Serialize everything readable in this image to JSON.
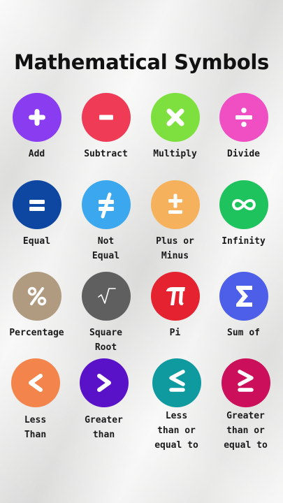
{
  "title": "Mathematical Symbols",
  "symbols": [
    {
      "label": "Add",
      "color": "#8a3cf0",
      "icon": "plus-icon"
    },
    {
      "label": "Subtract",
      "color": "#ef3b55",
      "icon": "minus-icon"
    },
    {
      "label": "Multiply",
      "color": "#7ee03f",
      "icon": "multiply-icon"
    },
    {
      "label": "Divide",
      "color": "#f04fc4",
      "icon": "divide-icon"
    },
    {
      "label": "Equal",
      "color": "#0d47a1",
      "icon": "equal-icon"
    },
    {
      "label": "Not\nEqual",
      "color": "#3ba7ef",
      "icon": "not-equal-icon"
    },
    {
      "label": "Plus or\nMinus",
      "color": "#f6b15c",
      "icon": "plus-minus-icon"
    },
    {
      "label": "Infinity",
      "color": "#1fc35d",
      "icon": "infinity-icon"
    },
    {
      "label": "Percentage",
      "color": "#b09b80",
      "icon": "percent-icon"
    },
    {
      "label": "Square\nRoot",
      "color": "#5f5f5f",
      "icon": "square-root-icon"
    },
    {
      "label": "Pi",
      "color": "#e5222f",
      "icon": "pi-icon"
    },
    {
      "label": "Sum of",
      "color": "#4d5fe8",
      "icon": "sigma-icon"
    },
    {
      "label": "Less\nThan",
      "color": "#f3844c",
      "icon": "less-than-icon"
    },
    {
      "label": "Greater\nthan",
      "color": "#5a12c9",
      "icon": "greater-than-icon"
    },
    {
      "label": "Less\nthan or\nequal to",
      "color": "#0f9aa0",
      "icon": "less-than-or-equal-icon"
    },
    {
      "label": "Greater\nthan or\nequal to",
      "color": "#cc0f5a",
      "icon": "greater-than-or-equal-icon"
    }
  ]
}
